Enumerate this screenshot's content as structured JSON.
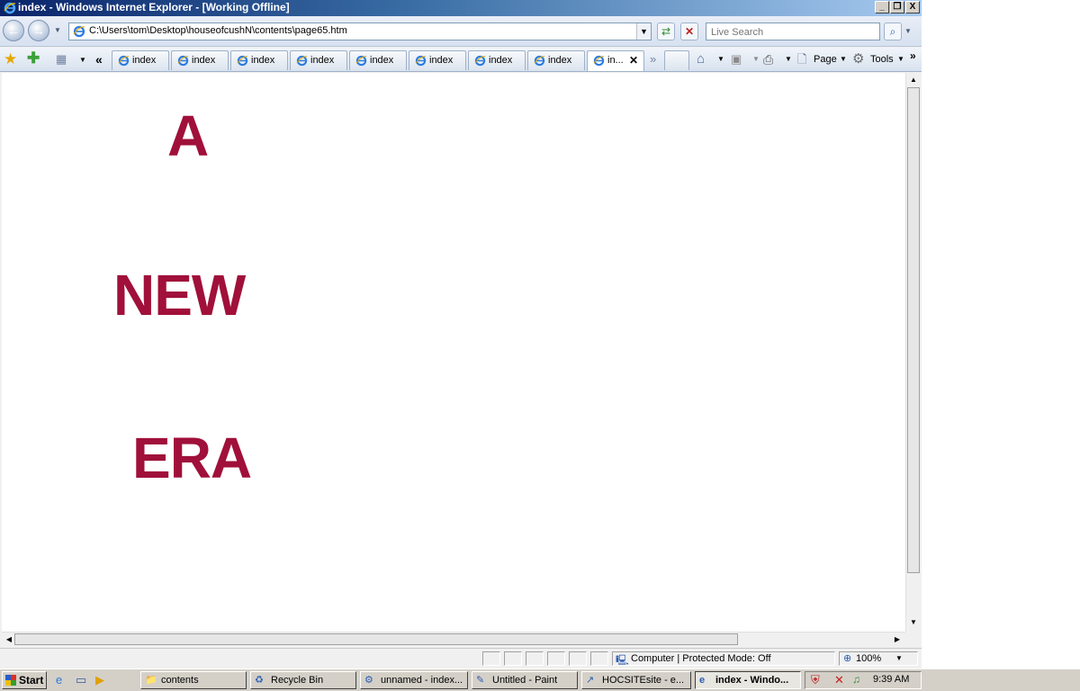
{
  "window": {
    "title": "index - Windows Internet Explorer - [Working Offline]",
    "controls": {
      "minimize": "_",
      "restore": "❐",
      "close": "X"
    }
  },
  "nav": {
    "address": "C:\\Users\\tom\\Desktop\\houseofcushN\\contents\\page65.htm",
    "search_placeholder": "Live Search"
  },
  "tabs": {
    "items": [
      {
        "label": "index"
      },
      {
        "label": "index"
      },
      {
        "label": "index"
      },
      {
        "label": "index"
      },
      {
        "label": "index"
      },
      {
        "label": "index"
      },
      {
        "label": "index"
      },
      {
        "label": "index"
      },
      {
        "label": "in..."
      }
    ],
    "left_chevron": "«",
    "right_chevron": "»"
  },
  "commands": {
    "page": "Page",
    "tools": "Tools",
    "more": "»"
  },
  "page": {
    "words": [
      "A",
      "NEW",
      "ERA"
    ],
    "color": "#a0103a"
  },
  "status": {
    "zone": "Computer | Protected Mode: Off",
    "zoom": "100%"
  },
  "taskbar": {
    "start": "Start",
    "tasks": [
      {
        "label": "contents",
        "icon": "folder-icon"
      },
      {
        "label": "Recycle Bin",
        "icon": "recycle-bin-icon"
      },
      {
        "label": "unnamed - index...",
        "icon": "app-icon"
      },
      {
        "label": "Untitled - Paint",
        "icon": "paint-icon"
      },
      {
        "label": "HOCSITEsite - e...",
        "icon": "editor-icon"
      },
      {
        "label": "index - Windo...",
        "icon": "ie-icon"
      }
    ],
    "clock": "9:39 AM"
  }
}
